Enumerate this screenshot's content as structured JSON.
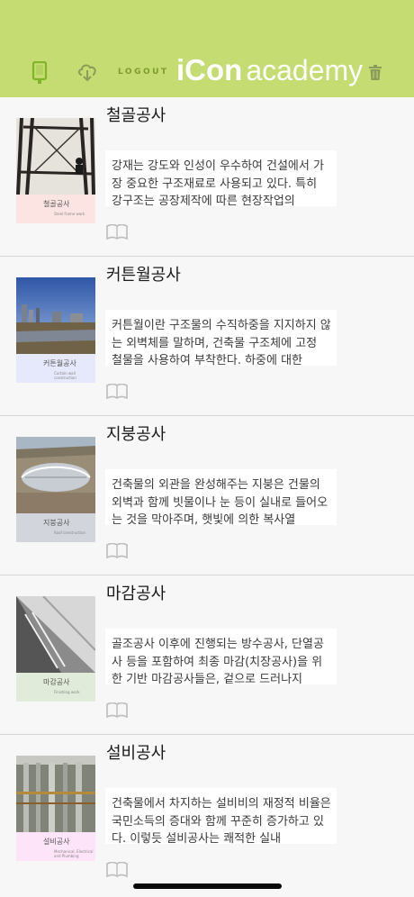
{
  "header": {
    "logout_label": "LOGOUT",
    "brand_bold": "iCon",
    "brand_light": "academy",
    "icons": [
      "phone-icon",
      "cloud-download-icon",
      "trash-icon"
    ]
  },
  "colors": {
    "header_bg": "#c5dc72",
    "accent": "#7fb527",
    "icon_gray": "#8c9a5a"
  },
  "courses": [
    {
      "title": "철골공사",
      "description": "강재는 강도와 인성이 우수하여 건설에서 가장 중요한 구조재료로 사용되고 있다. 특히 강구조는 공장제작에 따른 현장작업의",
      "cover_title": "철골공사",
      "cover_subtitle": "Steel frame work"
    },
    {
      "title": "커튼월공사",
      "description": "커튼월이란 구조물의 수직하중을 지지하지 않는 외벽체를 말하며, 건축물 구조체에 고정 철물을 사용하여 부착한다. 하중에 대한",
      "cover_title": "커튼월공사",
      "cover_subtitle": "Curtain wall construction"
    },
    {
      "title": "지붕공사",
      "description": "건축물의 외관을 완성해주는 지붕은 건물의 외벽과 함께 빗물이나 눈 등이 실내로 들어오는 것을 막아주며, 햇빛에 의한 복사열",
      "cover_title": "지붕공사",
      "cover_subtitle": "Roof construction"
    },
    {
      "title": "마감공사",
      "description": "골조공사 이후에 진행되는 방수공사, 단열공사 등을 포함하여 최종 마감(치장공사)을 위한 기반 마감공사들은, 겉으로 드러나지",
      "cover_title": "마감공사",
      "cover_subtitle": "Finishing work"
    },
    {
      "title": "설비공사",
      "description": "건축물에서 차지하는 설비비의 재정적 비율은 국민소득의 증대와 함께 꾸준히 증가하고 있다. 이렇듯 설비공사는 쾌적한 실내",
      "cover_title": "설비공사",
      "cover_subtitle": "Mechanical, Electrical and Plumbing"
    }
  ]
}
